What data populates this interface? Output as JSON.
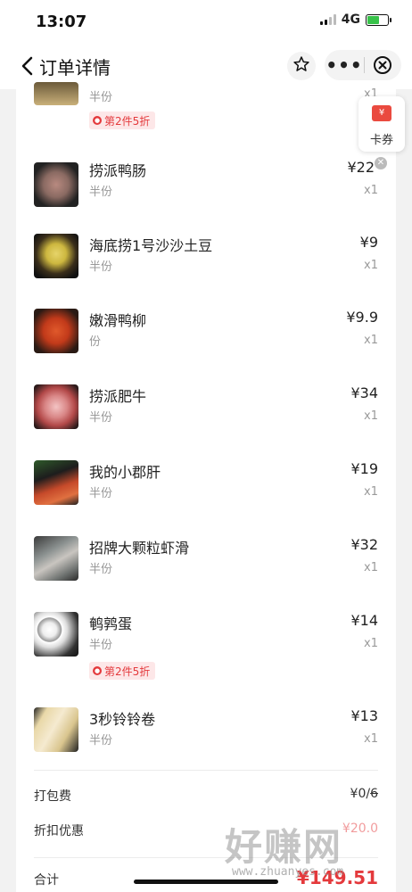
{
  "status_bar": {
    "time": "13:07",
    "network": "4G"
  },
  "nav": {
    "title": "订单详情",
    "icons": [
      "back-icon",
      "star-icon",
      "more-icon",
      "close-icon"
    ]
  },
  "coupon_float": {
    "label": "卡券",
    "icon_symbol": "¥"
  },
  "promo_label": "第2件5折",
  "items": [
    {
      "name": "",
      "spec": "半份",
      "price": "",
      "qty": "x1"
    },
    {
      "name": "捞派鸭肠",
      "spec": "半份",
      "price": "¥22",
      "qty": "x1"
    },
    {
      "name": "海底捞1号沙沙土豆",
      "spec": "半份",
      "price": "¥9",
      "qty": "x1"
    },
    {
      "name": "嫩滑鸭柳",
      "spec": "份",
      "price": "¥9.9",
      "qty": "x1"
    },
    {
      "name": "捞派肥牛",
      "spec": "半份",
      "price": "¥34",
      "qty": "x1"
    },
    {
      "name": "我的小郡肝",
      "spec": "半份",
      "price": "¥19",
      "qty": "x1"
    },
    {
      "name": "招牌大颗粒虾滑",
      "spec": "半份",
      "price": "¥32",
      "qty": "x1"
    },
    {
      "name": "鹌鹑蛋",
      "spec": "半份",
      "price": "¥14",
      "qty": "x1"
    },
    {
      "name": "3秒铃铃卷",
      "spec": "半份",
      "price": "¥13",
      "qty": "x1"
    }
  ],
  "summary": {
    "packing_label": "打包费",
    "packing_value": "¥0/",
    "packing_original": "6",
    "discount_label": "折扣优惠",
    "discount_value": "¥20.0",
    "total_label": "合计",
    "total_value": "¥149.51"
  },
  "watermark": {
    "big": "好赚网",
    "small": "www.zhuanyes.com"
  },
  "colors": {
    "accent_red": "#e4393c",
    "badge_bg": "#fde7e8",
    "text_gray": "#999999"
  }
}
